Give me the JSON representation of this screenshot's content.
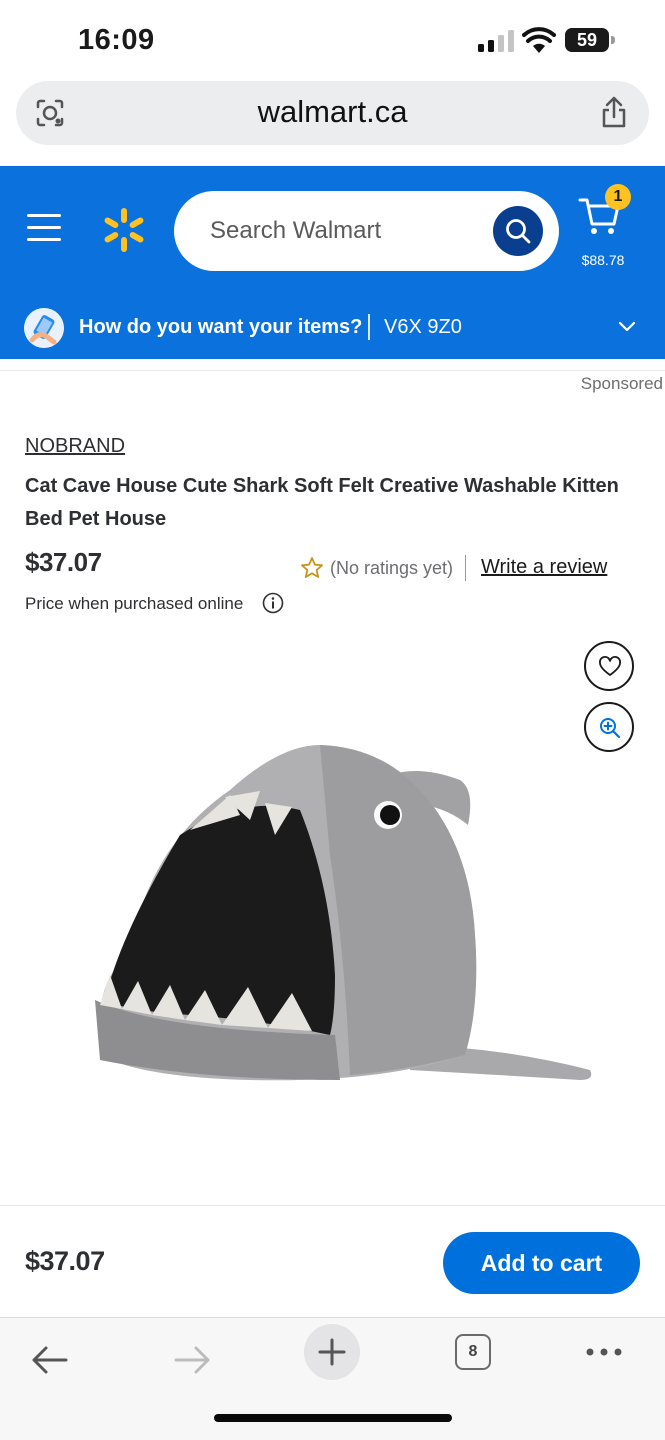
{
  "status_bar": {
    "time": "16:09",
    "battery": "59"
  },
  "browser": {
    "url": "walmart.ca"
  },
  "header": {
    "search_placeholder": "Search Walmart",
    "cart_count": "1",
    "cart_total": "$88.78",
    "delivery_prompt": "How do you want your items?",
    "postal_code": "V6X 9Z0",
    "brand_color": "#0b71dc",
    "spark_color": "#ffc220"
  },
  "product": {
    "sponsored_label": "Sponsored",
    "brand": "NOBRAND",
    "title": "Cat Cave House Cute Shark Soft Felt Creative Washable Kitten Bed Pet House",
    "price": "$37.07",
    "ratings": "(No ratings yet)",
    "write_review": "Write a review",
    "price_note": "Price when purchased online"
  },
  "buy_bar": {
    "price": "$37.07",
    "add_to_cart": "Add to cart"
  },
  "toolbar": {
    "tabs_count": "8"
  },
  "icons": [
    "camera-lens-icon",
    "share-icon",
    "menu-icon",
    "walmart-spark-icon",
    "search-icon",
    "cart-icon",
    "delivery-phone-icon",
    "chevron-down-icon",
    "star-icon",
    "info-icon",
    "heart-icon",
    "zoom-in-icon",
    "back-arrow-icon",
    "forward-arrow-icon",
    "plus-icon",
    "more-icon"
  ]
}
